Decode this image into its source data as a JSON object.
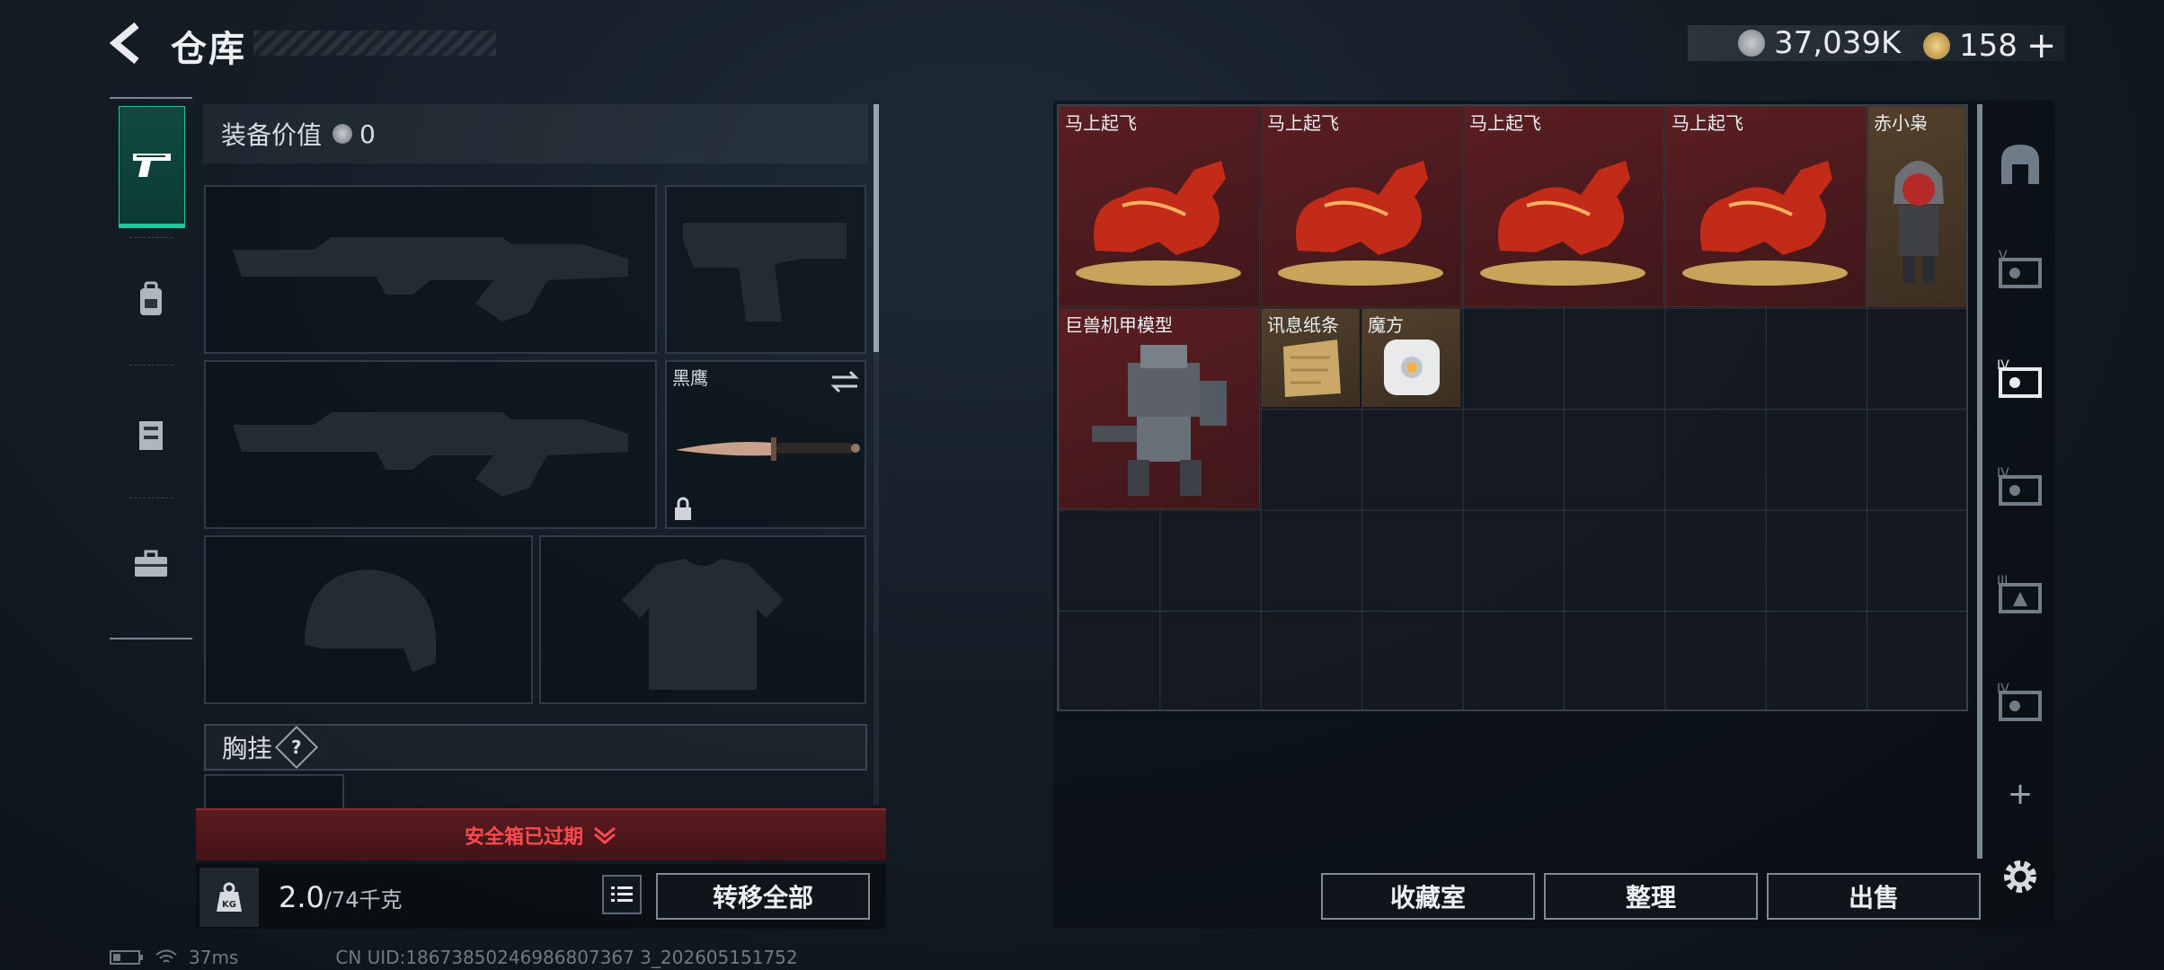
{
  "header": {
    "title": "仓库",
    "back_icon": "back-arrow-icon",
    "currency_a": "37,039K",
    "currency_b": "158",
    "currency_b_plus": "+"
  },
  "tabs": [
    {
      "icon": "pistol-icon",
      "active": true
    },
    {
      "icon": "backpack-icon",
      "active": false
    },
    {
      "icon": "vest-icon",
      "active": false
    },
    {
      "icon": "case-icon",
      "active": false
    }
  ],
  "loadout": {
    "equip_value_label": "装备价值",
    "equip_value": "0",
    "knife_label": "黑鹰",
    "chest_label": "胸挂",
    "chest_help": "?",
    "safe_box_text": "安全箱已过期",
    "weight_value": "2.0",
    "weight_capacity": "/74千克",
    "kg_label": "KG",
    "transfer_all": "转移全部"
  },
  "inventory": {
    "items": [
      {
        "label": "马上起飞",
        "kind": "horse"
      },
      {
        "label": "马上起飞",
        "kind": "horse"
      },
      {
        "label": "马上起飞",
        "kind": "horse"
      },
      {
        "label": "马上起飞",
        "kind": "horse"
      },
      {
        "label": "赤小枭",
        "kind": "figure"
      },
      {
        "label": "巨兽机甲模型",
        "kind": "mech"
      },
      {
        "label": "讯息纸条",
        "kind": "note"
      },
      {
        "label": "魔方",
        "kind": "cube"
      }
    ],
    "buttons": {
      "collection": "收藏室",
      "sort": "整理",
      "sell": "出售"
    },
    "side_icons": [
      "home-icon",
      "level-v-card-icon",
      "level-iv-card-icon",
      "level-iv-card-icon",
      "level-iii-card-icon",
      "level-iv-card-icon",
      "add-icon",
      "settings-icon"
    ],
    "side_labels": [
      "V",
      "IV",
      "IV",
      "III",
      "IV"
    ],
    "add_symbol": "+"
  },
  "status_bar": {
    "ping": "37ms",
    "uid": "CN UID:18673850246986807367 3_202605151752"
  }
}
